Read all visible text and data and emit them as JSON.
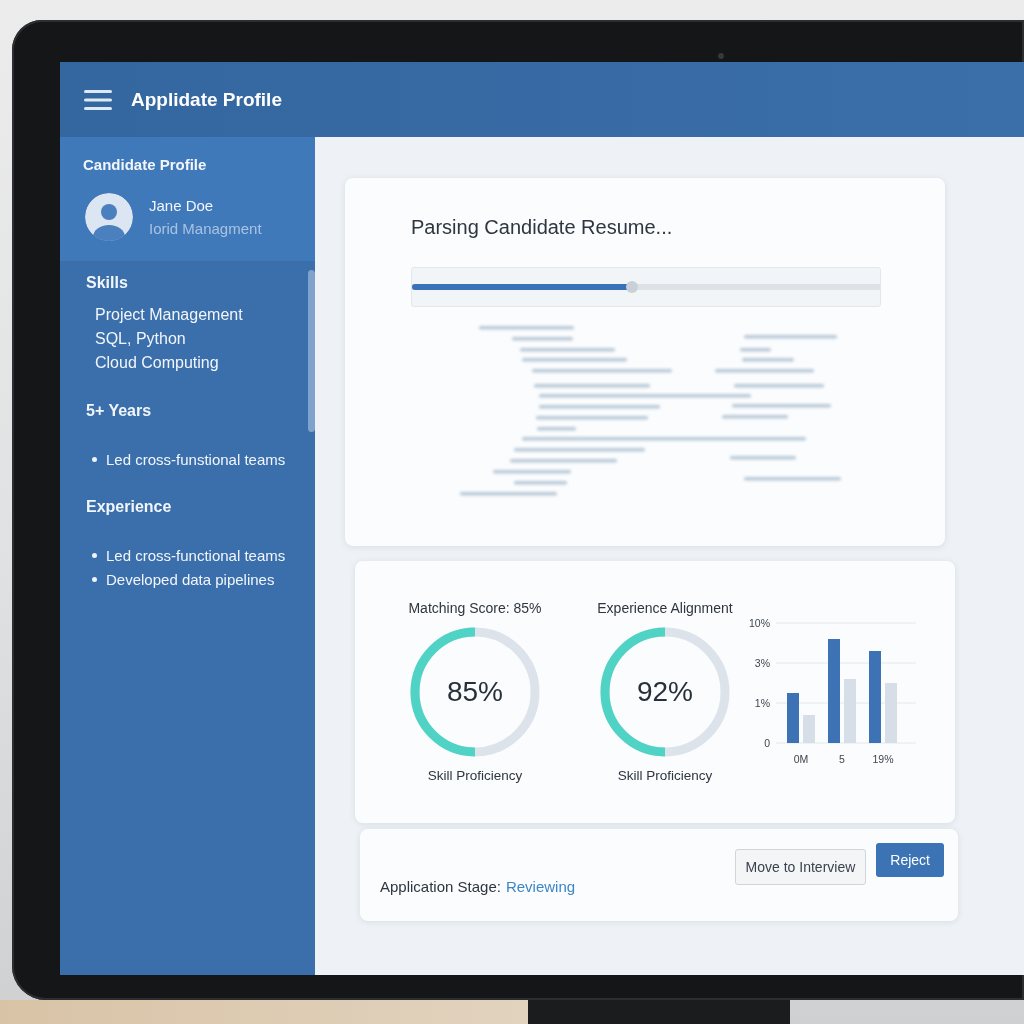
{
  "header": {
    "title": "Applidate Profile"
  },
  "sidebar": {
    "title": "Candidate Profile",
    "profile": {
      "name": "Jane Doe",
      "subtitle": "Iorid Managment"
    },
    "sections": [
      {
        "kind": "plain",
        "heading": "Skills",
        "items": [
          "Project Management",
          "SQL, Python",
          "Cloud Computing"
        ]
      },
      {
        "kind": "bulleted",
        "heading": "5+ Years",
        "items": [
          "Led cross-funstional teams"
        ]
      },
      {
        "kind": "bulleted",
        "heading": "Experience",
        "items": [
          "Led cross-functional teams",
          "Developed data pipelines"
        ]
      }
    ]
  },
  "resume_card": {
    "title": "Parsing Candidate Resume...",
    "progress": {
      "level": 0.47
    }
  },
  "gauges": [
    {
      "title": "Matching Score: 85%",
      "value": "85%",
      "level": 0.5,
      "caption": "Skill Proficiency"
    },
    {
      "title": "Experience Alignment",
      "value": "92%",
      "level": 0.5,
      "caption": "Skill Proficiency"
    }
  ],
  "bar_chart": {
    "y_axis_labels": [
      "10%",
      "3%",
      "1%",
      "0"
    ],
    "x_axis_labels": [
      "0M",
      "5",
      "19%"
    ]
  },
  "footer": {
    "stage_label": "Application Stage:",
    "stage_value": "Reviewing",
    "buttons": [
      {
        "label": "Move to Interview",
        "kind": "secondary"
      },
      {
        "label": "Reject",
        "kind": "primary"
      }
    ]
  }
}
